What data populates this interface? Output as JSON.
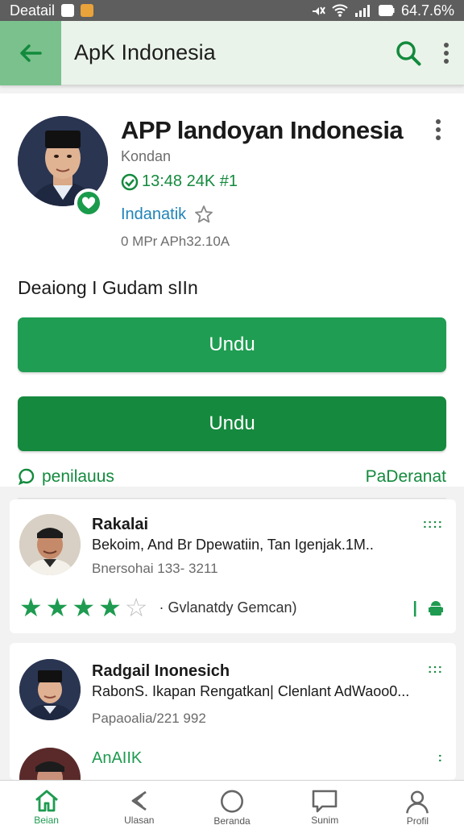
{
  "statusbar": {
    "carrier": "Deatail",
    "right_text": "64.7.6%"
  },
  "appbar": {
    "title": "ApK Indonesia"
  },
  "app": {
    "title": "APP landoyan Indonesia",
    "developer": "Kondan",
    "stats": "13:48 24K #1",
    "category": "Indanatik",
    "size": "0 MPr APh32.10A",
    "description": "Deaiong I Gudam sIIn"
  },
  "buttons": {
    "primary": "Undu",
    "secondary": "Undu"
  },
  "ratings": {
    "label": "penilauus",
    "see_all": "PaDeranat"
  },
  "reviews": [
    {
      "name": "Rakalai",
      "text": "Bekoim, And Br Dpewatiin, Tan Igenjak.1M..",
      "date": "Bnersohai 133- 3211",
      "more": "::::",
      "rating": 4,
      "helpful": "Gvlanatdy Gemcan)"
    },
    {
      "name": "Radgail Inonesich",
      "text": "RabonS. Ikapan Rengatkan| Clenlant AdWaoo0...",
      "date": "Papaoalia/221 992",
      "more": ":::"
    },
    {
      "name": "AnAIIK",
      "text": "",
      "more": ":"
    }
  ],
  "nav": [
    {
      "icon": "home-icon",
      "label": "Beian"
    },
    {
      "icon": "back-icon",
      "label": "Ulasan"
    },
    {
      "icon": "circle-icon",
      "label": "Beranda"
    },
    {
      "icon": "chat-icon",
      "label": "Sunim"
    },
    {
      "icon": "profile-icon",
      "label": "Profil"
    }
  ],
  "colors": {
    "accent": "#1e9b50",
    "appbar_bg": "#eaf3ea",
    "back_bg": "#7bc18d"
  }
}
